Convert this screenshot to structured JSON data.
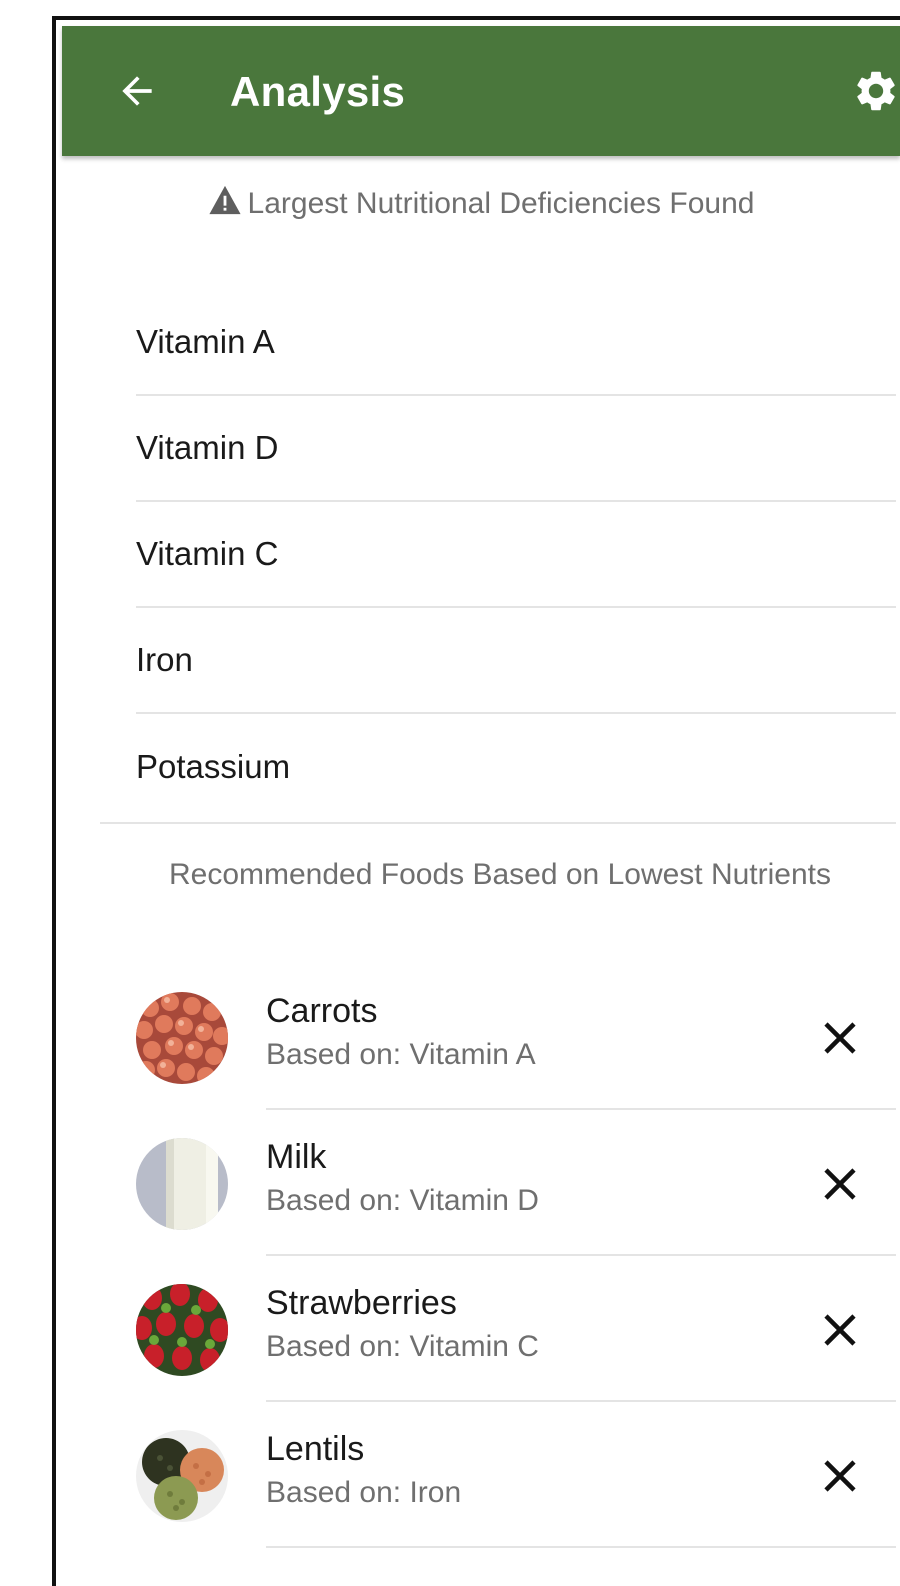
{
  "appbar": {
    "title": "Analysis",
    "color": "#4a773c"
  },
  "deficiencies": {
    "header": "Largest Nutritional Deficiencies Found",
    "items": [
      "Vitamin A",
      "Vitamin D",
      "Vitamin C",
      "Iron",
      "Potassium"
    ]
  },
  "recommendations": {
    "header": "Recommended Foods Based on Lowest Nutrients",
    "items": [
      {
        "name": "Carrots",
        "based_on": "Based on: Vitamin A",
        "image": "carrots-photo"
      },
      {
        "name": "Milk",
        "based_on": "Based on: Vitamin D",
        "image": "milk-photo"
      },
      {
        "name": "Strawberries",
        "based_on": "Based on: Vitamin C",
        "image": "strawberries-photo"
      },
      {
        "name": "Lentils",
        "based_on": "Based on: Iron",
        "image": "lentils-photo"
      }
    ]
  },
  "icons": {
    "back": "arrow-left-icon",
    "settings": "gear-icon",
    "warning": "warning-icon",
    "remove": "close-icon"
  }
}
